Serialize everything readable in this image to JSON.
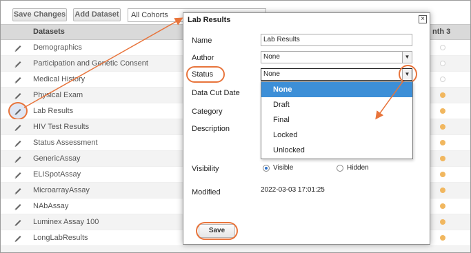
{
  "toolbar": {
    "save_changes_label": "Save Changes",
    "add_dataset_label": "Add Dataset",
    "cohort_value": "All Cohorts"
  },
  "grid": {
    "header_datasets": "Datasets",
    "header_month": "nth 3",
    "rows": [
      {
        "name": "Demographics",
        "dot": "empty"
      },
      {
        "name": "Participation and Genetic Consent",
        "dot": "empty"
      },
      {
        "name": "Medical History",
        "dot": "empty"
      },
      {
        "name": "Physical Exam",
        "dot": "filled"
      },
      {
        "name": "Lab Results",
        "dot": "filled"
      },
      {
        "name": "HIV Test Results",
        "dot": "filled"
      },
      {
        "name": "Status Assessment",
        "dot": "filled"
      },
      {
        "name": "GenericAssay",
        "dot": "filled"
      },
      {
        "name": "ELISpotAssay",
        "dot": "filled"
      },
      {
        "name": "MicroarrayAssay",
        "dot": "filled"
      },
      {
        "name": "NAbAssay",
        "dot": "filled"
      },
      {
        "name": "Luminex Assay 100",
        "dot": "filled"
      },
      {
        "name": "LongLabResults",
        "dot": "filled"
      },
      {
        "name": "",
        "dot": "none"
      }
    ]
  },
  "modal": {
    "title": "Lab Results",
    "close_glyph": "×",
    "labels": {
      "name": "Name",
      "author": "Author",
      "status": "Status",
      "data_cut_date": "Data Cut Date",
      "category": "Category",
      "description": "Description",
      "visibility": "Visibility",
      "modified": "Modified"
    },
    "name_value": "Lab Results",
    "author_value": "None",
    "status_value": "None",
    "status_options": [
      "None",
      "Draft",
      "Final",
      "Locked",
      "Unlocked"
    ],
    "status_selected_index": 0,
    "visibility": {
      "visible_label": "Visible",
      "hidden_label": "Hidden",
      "selected": "Visible"
    },
    "modified_value": "2022-03-03 17:01:25",
    "save_label": "Save"
  },
  "colors": {
    "annotation": "#e8743b",
    "selected_option": "#3d8fd7",
    "filled_dot": "#f1b75f"
  }
}
